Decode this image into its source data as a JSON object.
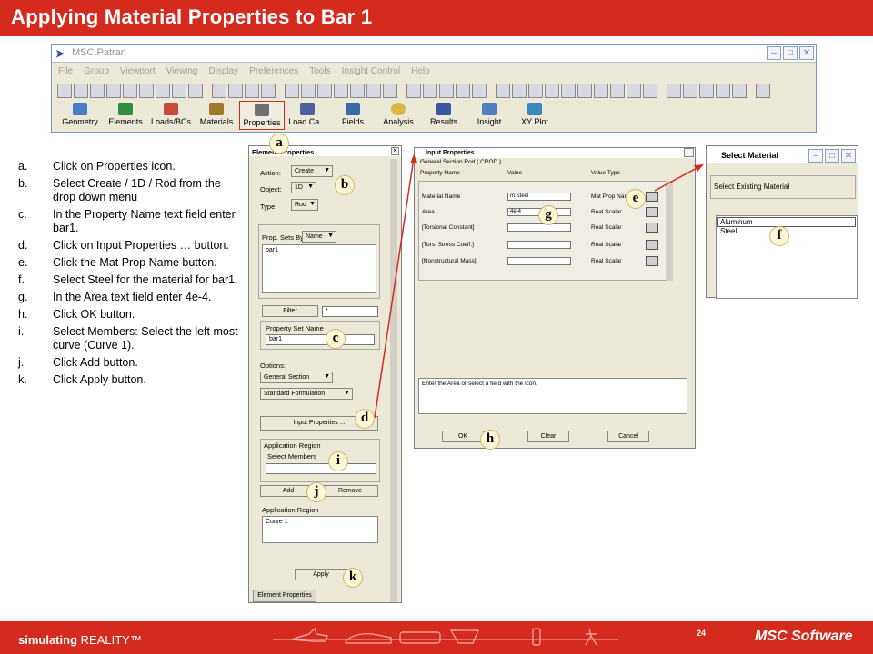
{
  "slide": {
    "title": "Applying Material Properties to Bar 1",
    "page": "24"
  },
  "patran": {
    "title": "MSC.Patran",
    "menu": [
      "File",
      "Group",
      "Viewport",
      "Viewing",
      "Display",
      "Preferences",
      "Tools",
      "Insight Control",
      "Help"
    ],
    "apps": [
      "Geometry",
      "Elements",
      "Loads/BCs",
      "Materials",
      "Properties",
      "Load Ca...",
      "Fields",
      "Analysis",
      "Results",
      "Insight",
      "XY Plot"
    ],
    "selected_app": "Properties"
  },
  "steps": [
    {
      "k": "a.",
      "t": "Click on Properties icon."
    },
    {
      "k": "b.",
      "t": "Select Create / 1D / Rod from the drop down menu"
    },
    {
      "k": "c.",
      "t": "In the Property Name text field enter bar1."
    },
    {
      "k": "d.",
      "t": "Click on Input Properties … button."
    },
    {
      "k": "e.",
      "t": "Click the Mat Prop Name button."
    },
    {
      "k": "f.",
      "t": "Select Steel for the material for bar1."
    },
    {
      "k": "g.",
      "t": "In the Area text field enter 4e-4."
    },
    {
      "k": "h.",
      "t": "Click OK button."
    },
    {
      "k": "i.",
      "t": "Select Members: Select the left most curve (Curve 1)."
    },
    {
      "k": "j.",
      "t": "Click Add button."
    },
    {
      "k": "k.",
      "t": "Click Apply button."
    }
  ],
  "element_properties": {
    "title": "Element Properties",
    "action_label": "Action:",
    "action": "Create",
    "object_label": "Object:",
    "object": "1D",
    "type_label": "Type:",
    "type": "Rod",
    "prop_sets_label": "Prop. Sets By",
    "prop_sets_by": "Name",
    "prop_sets": [
      "bar1"
    ],
    "filter_button": "Filter",
    "filter_value": "*",
    "property_set_name_label": "Property Set Name",
    "property_set_name": "bar1",
    "options_label": "Options:",
    "option1": "General Section",
    "option2": "Standard Formulation",
    "input_properties_button": "Input Properties ...",
    "application_region_label": "Application Region",
    "select_members_label": "Select Members",
    "add_button": "Add",
    "remove_button": "Remove",
    "application_region_label2": "Application Region",
    "region_items": [
      "Curve 1"
    ],
    "apply_button": "Apply",
    "tab": "Element Properties"
  },
  "input_properties": {
    "title": "Input Properties",
    "caption": "General Section Rod ( CROD )",
    "headers": {
      "name": "Property Name",
      "value": "Value",
      "type": "Value Type"
    },
    "rows": [
      {
        "name": "Material Name",
        "value": "m:Steel",
        "type": "Mat Prop Name"
      },
      {
        "name": "Area",
        "value": "4e-4",
        "type": "Real Scalar"
      },
      {
        "name": "[Torsional Constant]",
        "value": "",
        "type": "Real Scalar"
      },
      {
        "name": "[Tors. Stress Coeff.]",
        "value": "",
        "type": "Real Scalar"
      },
      {
        "name": "[Nonstructural Mass]",
        "value": "",
        "type": "Real Scalar"
      }
    ],
    "message": "Enter the Area or select a field with the icon.",
    "ok_button": "OK",
    "clear_button": "Clear",
    "cancel_button": "Cancel"
  },
  "select_material": {
    "title": "Select Material",
    "label": "Select Existing Material",
    "items": [
      "Aluminum",
      "Steel"
    ]
  },
  "markers": [
    "a",
    "b",
    "c",
    "d",
    "e",
    "f",
    "g",
    "h",
    "i",
    "j",
    "k"
  ],
  "footer": {
    "brand": "simulating",
    "brand2": "REALITY™",
    "logo": "MSC Software"
  }
}
